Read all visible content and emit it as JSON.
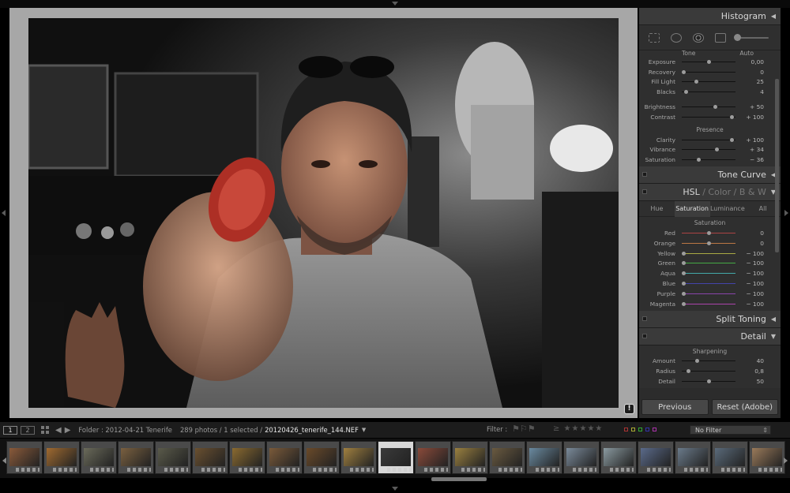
{
  "right_panel": {
    "histogram_title": "Histogram",
    "tone_labels": [
      "Tone",
      "Auto"
    ],
    "basic": [
      {
        "label": "Exposure",
        "value": "0,00",
        "pos": 0.5
      },
      {
        "label": "Recovery",
        "value": "0",
        "pos": 0.0
      },
      {
        "label": "Fill Light",
        "value": "25",
        "pos": 0.25
      },
      {
        "label": "Blacks",
        "value": "4",
        "pos": 0.04
      }
    ],
    "basic2": [
      {
        "label": "Brightness",
        "value": "+ 50",
        "pos": 0.62
      },
      {
        "label": "Contrast",
        "value": "+ 100",
        "pos": 0.95
      }
    ],
    "presence_title": "Presence",
    "presence": [
      {
        "label": "Clarity",
        "value": "+ 100",
        "pos": 0.95
      },
      {
        "label": "Vibrance",
        "value": "+ 34",
        "pos": 0.65
      },
      {
        "label": "Saturation",
        "value": "− 36",
        "pos": 0.3
      }
    ],
    "tone_curve_title": "Tone Curve",
    "hsl_title": {
      "hsl": "HSL",
      "sep1": " / ",
      "color": "Color",
      "sep2": " / ",
      "bw": "B & W"
    },
    "hsl_tabs": [
      "Hue",
      "Saturation",
      "Luminance",
      "All"
    ],
    "saturation_title": "Saturation",
    "hsl_sat": [
      {
        "label": "Red",
        "value": "0",
        "pos": 0.5
      },
      {
        "label": "Orange",
        "value": "0",
        "pos": 0.5
      },
      {
        "label": "Yellow",
        "value": "− 100",
        "pos": 0.0
      },
      {
        "label": "Green",
        "value": "− 100",
        "pos": 0.0
      },
      {
        "label": "Aqua",
        "value": "− 100",
        "pos": 0.0
      },
      {
        "label": "Blue",
        "value": "− 100",
        "pos": 0.0
      },
      {
        "label": "Purple",
        "value": "− 100",
        "pos": 0.0
      },
      {
        "label": "Magenta",
        "value": "− 100",
        "pos": 0.0
      }
    ],
    "split_toning_title": "Split Toning",
    "detail_title": "Detail",
    "sharpening_title": "Sharpening",
    "detail": [
      {
        "label": "Amount",
        "value": "40",
        "pos": 0.27
      },
      {
        "label": "Radius",
        "value": "0,8",
        "pos": 0.1
      },
      {
        "label": "Detail",
        "value": "50",
        "pos": 0.5
      }
    ],
    "previous_button": "Previous",
    "reset_button": "Reset (Adobe)"
  },
  "toolbar": {
    "monitor1": "1",
    "monitor2": "2",
    "folder": "Folder : 2012-04-21 Tenerife",
    "count": "289 photos / 1 selected /",
    "filename": "20120426_tenerife_144.NEF",
    "filter_label": "Filter :",
    "no_filter": "No Filter"
  },
  "filmstrip": {
    "count": 21,
    "selected_index": 10
  },
  "colors": {
    "panel_bg": "#2c2c2c",
    "header_bg": "#3a3a3a",
    "canvas_bg": "#a7a7a7"
  }
}
